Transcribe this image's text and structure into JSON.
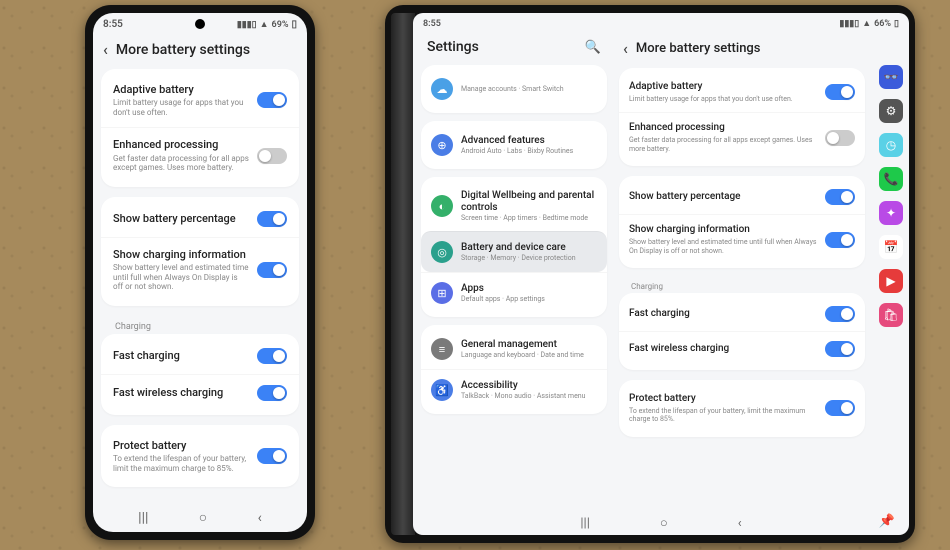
{
  "phone": {
    "status": {
      "time": "8:55",
      "battery": "69%",
      "signal": "▮▮▮▯",
      "wifi": "▲"
    },
    "header": "More battery settings",
    "sections": [
      {
        "rows": [
          {
            "title": "Adaptive battery",
            "sub": "Limit battery usage for apps that you don't use often.",
            "toggle": "on"
          },
          {
            "title": "Enhanced processing",
            "sub": "Get faster data processing for all apps except games. Uses more battery.",
            "toggle": "off"
          }
        ]
      },
      {
        "rows": [
          {
            "title": "Show battery percentage",
            "sub": "",
            "toggle": "on"
          },
          {
            "title": "Show charging information",
            "sub": "Show battery level and estimated time until full when Always On Display is off or not shown.",
            "toggle": "on"
          }
        ]
      },
      {
        "label": "Charging",
        "rows": [
          {
            "title": "Fast charging",
            "sub": "",
            "toggle": "on"
          },
          {
            "title": "Fast wireless charging",
            "sub": "",
            "toggle": "on"
          }
        ]
      },
      {
        "rows": [
          {
            "title": "Protect battery",
            "sub": "To extend the lifespan of your battery, limit the maximum charge to 85%.",
            "toggle": "on"
          }
        ]
      }
    ]
  },
  "tablet": {
    "status": {
      "time": "8:55",
      "battery": "66%",
      "signal": "▮▮▮▯",
      "wifi": "▲"
    },
    "left_header": "Settings",
    "left": [
      {
        "rows": [
          {
            "icon": "☁",
            "color": "#4aa0e6",
            "title": "",
            "sub": "Manage accounts · Smart Switch"
          }
        ]
      },
      {
        "rows": [
          {
            "icon": "⊕",
            "color": "#4a7de6",
            "title": "Advanced features",
            "sub": "Android Auto · Labs · Bixby Routines"
          }
        ]
      },
      {
        "rows": [
          {
            "icon": "◐",
            "color": "#34b06a",
            "title": "Digital Wellbeing and parental controls",
            "sub": "Screen time · App timers · Bedtime mode"
          },
          {
            "icon": "◎",
            "color": "#2aa08c",
            "title": "Battery and device care",
            "sub": "Storage · Memory · Device protection",
            "active": true
          },
          {
            "icon": "⊞",
            "color": "#5a6ee6",
            "title": "Apps",
            "sub": "Default apps · App settings"
          }
        ]
      },
      {
        "rows": [
          {
            "icon": "≡",
            "color": "#7a7a7a",
            "title": "General management",
            "sub": "Language and keyboard · Date and time"
          },
          {
            "icon": "♿",
            "color": "#4a7de6",
            "title": "Accessibility",
            "sub": "TalkBack · Mono audio · Assistant menu"
          }
        ]
      }
    ],
    "right_header": "More battery settings",
    "right": [
      {
        "rows": [
          {
            "title": "Adaptive battery",
            "sub": "Limit battery usage for apps that you don't use often.",
            "toggle": "on"
          },
          {
            "title": "Enhanced processing",
            "sub": "Get faster data processing for all apps except games. Uses more battery.",
            "toggle": "off"
          }
        ]
      },
      {
        "rows": [
          {
            "title": "Show battery percentage",
            "sub": "",
            "toggle": "on"
          },
          {
            "title": "Show charging information",
            "sub": "Show battery level and estimated time until full when Always On Display is off or not shown.",
            "toggle": "on"
          }
        ]
      },
      {
        "label": "Charging",
        "rows": [
          {
            "title": "Fast charging",
            "sub": "",
            "toggle": "on"
          },
          {
            "title": "Fast wireless charging",
            "sub": "",
            "toggle": "on"
          }
        ]
      },
      {
        "rows": [
          {
            "title": "Protect battery",
            "sub": "To extend the lifespan of your battery, limit the maximum charge to 85%.",
            "toggle": "on"
          }
        ]
      }
    ],
    "dock": [
      {
        "color": "#3b5bdb",
        "glyph": "👓"
      },
      {
        "color": "#555",
        "glyph": "⚙"
      },
      {
        "color": "#5ad1e6",
        "glyph": "◷"
      },
      {
        "color": "#1ec94a",
        "glyph": "📞"
      },
      {
        "color": "#b94ae6",
        "glyph": "✦"
      },
      {
        "color": "#fff",
        "glyph": "📅",
        "fg": "#333"
      },
      {
        "color": "#e63b3b",
        "glyph": "▶"
      },
      {
        "color": "#e64a7d",
        "glyph": "🛍"
      }
    ]
  }
}
